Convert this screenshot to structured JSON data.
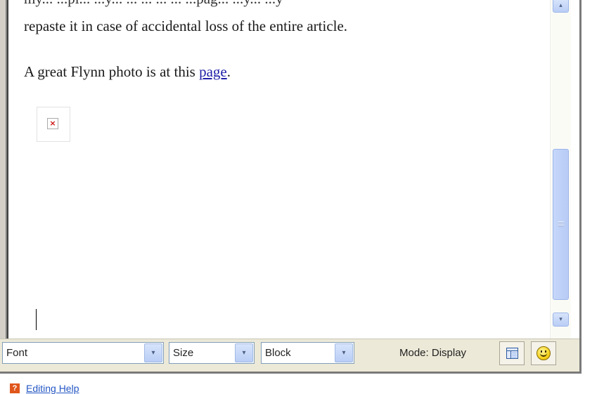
{
  "editor": {
    "cut_off_line": "my... ...pl... ...y... ... ... ... ... ...pag... ...y... ...y",
    "paragraph_1": "repaste it in case of accidental loss of the entire article.",
    "paragraph_2_prefix": "A great Flynn photo is at this ",
    "paragraph_2_link": "page",
    "paragraph_2_suffix": ".",
    "broken_image_glyph": "×"
  },
  "toolbar": {
    "font_select": "Font",
    "size_select": "Size",
    "block_select": "Block",
    "mode_label": "Mode: Display"
  },
  "icons": {
    "dropdown_arrow": "▾",
    "scroll_up": "▴",
    "scroll_down": "▾",
    "layout_button": "layout-icon",
    "smiley_button": "smiley-icon",
    "help": "?"
  },
  "help": {
    "link_text": "Editing Help"
  },
  "colors": {
    "toolbar_bg": "#ece9d8",
    "link": "#1f1fa8",
    "scrollbar_thumb": "#c6d7fa",
    "help_icon": "#e0561c"
  }
}
